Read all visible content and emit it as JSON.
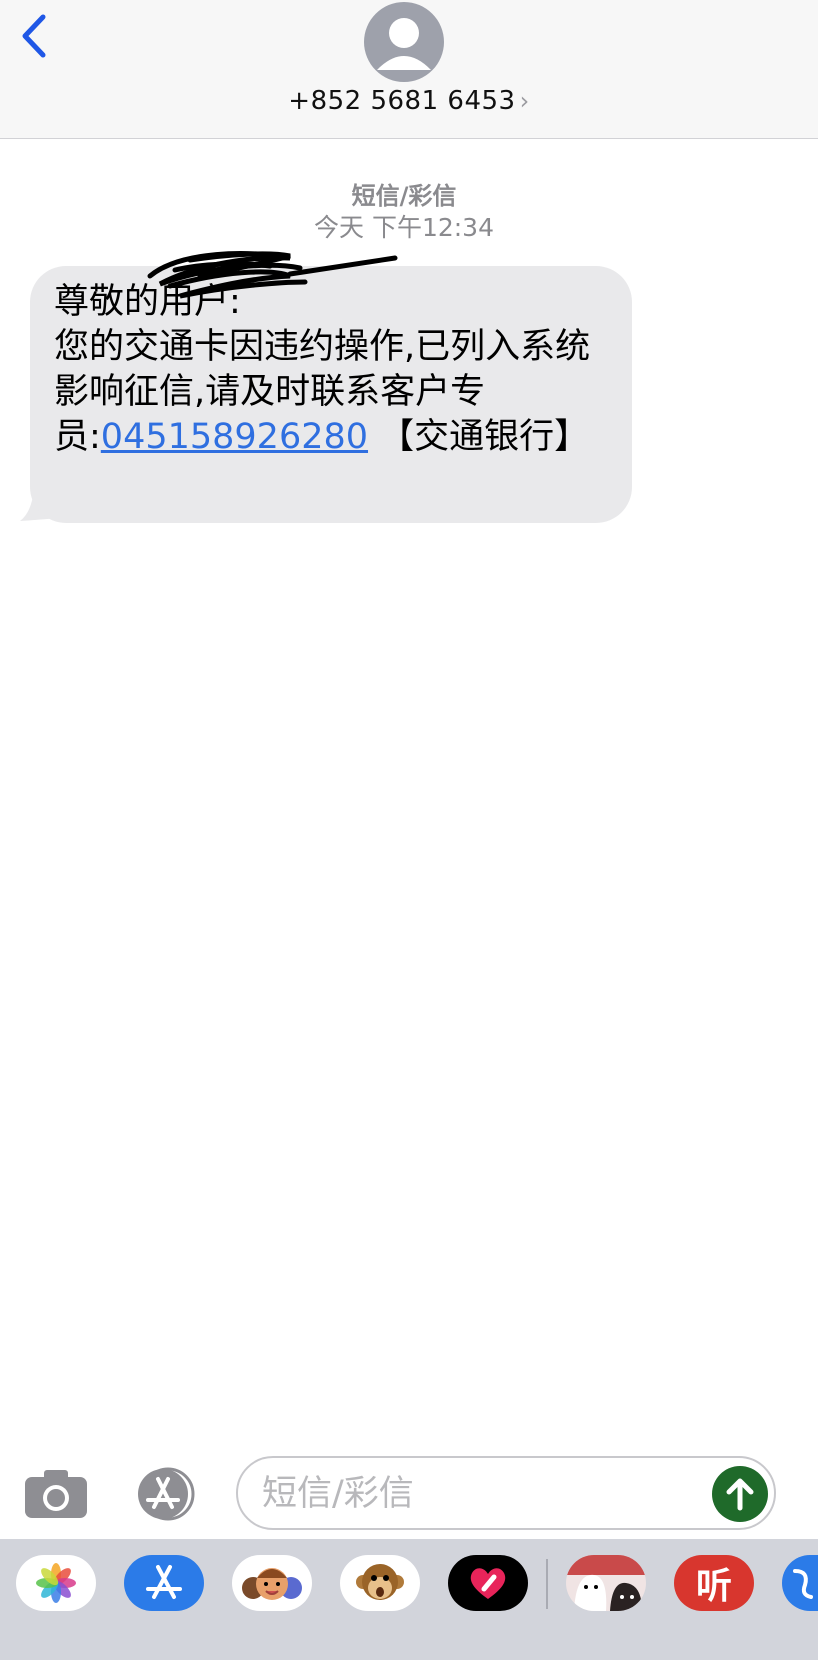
{
  "header": {
    "contact": "+852 5681 6453",
    "chevron": "›",
    "back_icon": "chevron-left-icon",
    "accent": "#1f57e6"
  },
  "meta": {
    "type": "短信/彩信",
    "time": "今天 下午12:34"
  },
  "message": {
    "greeting": "尊敬的",
    "greeting_rest": "用户:",
    "body": "您的交通卡因违约操作,已列入系统影响征信,请及时联系客户专员:",
    "phone": "045158926280",
    "suffix": " 【交通银行】",
    "link_color": "#2f6fe0"
  },
  "composer": {
    "placeholder": "短信/彩信",
    "send_color": "#1f6a2a"
  },
  "app_drawer": {
    "apps": [
      "photos-icon",
      "app-store-icon",
      "memoji-icon",
      "animoji-monkey-icon",
      "digital-touch-icon",
      "sticker-app-icon",
      "ting-app-icon",
      "blue-app-icon"
    ],
    "ting_label": "听"
  }
}
